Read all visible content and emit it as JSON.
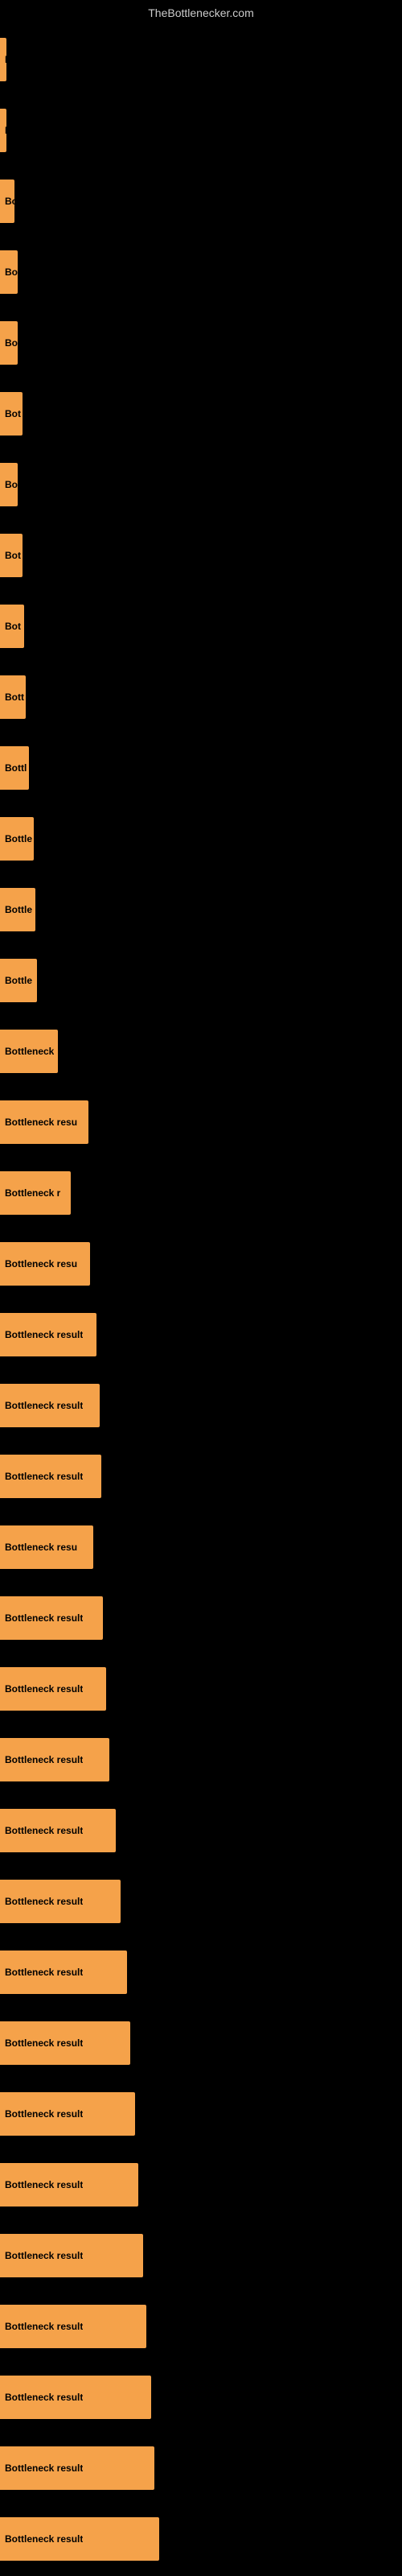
{
  "site": {
    "title": "TheBottlenecker.com"
  },
  "bars": [
    {
      "label": "B",
      "width": 8
    },
    {
      "label": "B",
      "width": 8
    },
    {
      "label": "Bo",
      "width": 18
    },
    {
      "label": "Bo",
      "width": 22
    },
    {
      "label": "Bo",
      "width": 22
    },
    {
      "label": "Bot",
      "width": 28
    },
    {
      "label": "Bo",
      "width": 22
    },
    {
      "label": "Bot",
      "width": 28
    },
    {
      "label": "Bot",
      "width": 30
    },
    {
      "label": "Bott",
      "width": 32
    },
    {
      "label": "Bottl",
      "width": 36
    },
    {
      "label": "Bottle",
      "width": 42
    },
    {
      "label": "Bottle",
      "width": 44
    },
    {
      "label": "Bottle",
      "width": 46
    },
    {
      "label": "Bottleneck",
      "width": 72
    },
    {
      "label": "Bottleneck resu",
      "width": 110
    },
    {
      "label": "Bottleneck r",
      "width": 88
    },
    {
      "label": "Bottleneck resu",
      "width": 112
    },
    {
      "label": "Bottleneck result",
      "width": 120
    },
    {
      "label": "Bottleneck result",
      "width": 124
    },
    {
      "label": "Bottleneck result",
      "width": 126
    },
    {
      "label": "Bottleneck resu",
      "width": 116
    },
    {
      "label": "Bottleneck result",
      "width": 128
    },
    {
      "label": "Bottleneck result",
      "width": 132
    },
    {
      "label": "Bottleneck result",
      "width": 136
    },
    {
      "label": "Bottleneck result",
      "width": 144
    },
    {
      "label": "Bottleneck result",
      "width": 150
    },
    {
      "label": "Bottleneck result",
      "width": 158
    },
    {
      "label": "Bottleneck result",
      "width": 162
    },
    {
      "label": "Bottleneck result",
      "width": 168
    },
    {
      "label": "Bottleneck result",
      "width": 172
    },
    {
      "label": "Bottleneck result",
      "width": 178
    },
    {
      "label": "Bottleneck result",
      "width": 182
    },
    {
      "label": "Bottleneck result",
      "width": 188
    },
    {
      "label": "Bottleneck result",
      "width": 192
    },
    {
      "label": "Bottleneck result",
      "width": 198
    }
  ]
}
